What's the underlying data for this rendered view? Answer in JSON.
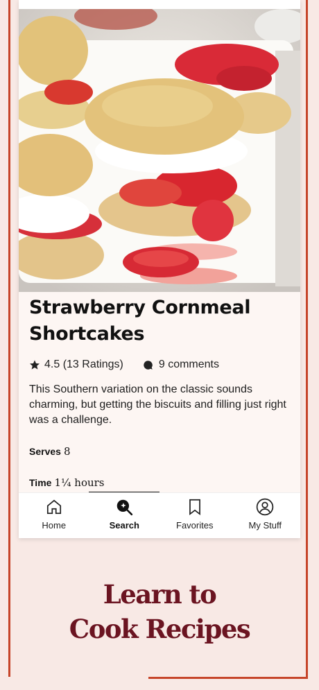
{
  "recipe": {
    "title_line1": "Strawberry Cornmeal",
    "title_line2": "Shortcakes",
    "rating": "4.5 (13 Ratings)",
    "comments": "9 comments",
    "description": "This Southern variation on the classic sounds charming, but getting the biscuits and filling just right was a challenge.",
    "serves_label": "Serves",
    "serves_value": "8",
    "time_label": "Time",
    "time_value": "1¼ hours"
  },
  "tabs": [
    {
      "label": "Home",
      "icon": "home-icon"
    },
    {
      "label": "Search",
      "icon": "search-icon",
      "active": true
    },
    {
      "label": "Favorites",
      "icon": "bookmark-icon"
    },
    {
      "label": "My Stuff",
      "icon": "user-icon"
    }
  ],
  "promo": {
    "line1": "Learn to",
    "line2": "Cook Recipes"
  },
  "colors": {
    "background": "#f8e9e5",
    "frame_accent": "#c6452a",
    "promo_text": "#6b1421",
    "card_background": "#fdf6f3"
  }
}
